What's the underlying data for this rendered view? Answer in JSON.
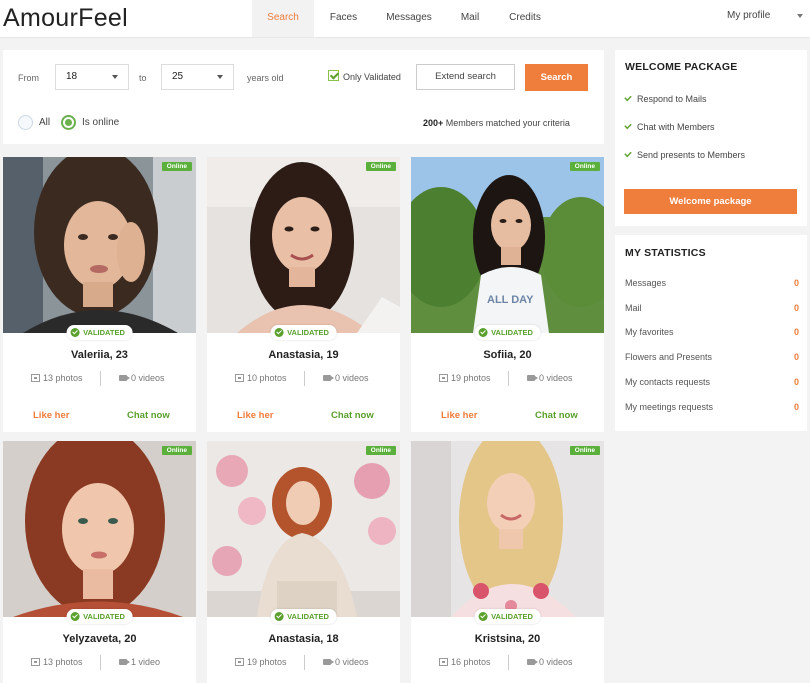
{
  "header": {
    "logo": "AmourFeel",
    "nav": [
      {
        "label": "Search",
        "active": true
      },
      {
        "label": "Faces",
        "active": false
      },
      {
        "label": "Messages",
        "active": false
      },
      {
        "label": "Mail",
        "active": false
      },
      {
        "label": "Credits",
        "active": false
      }
    ],
    "profile_label": "My profile"
  },
  "search": {
    "from_label": "From",
    "from_value": "18",
    "to_label": "to",
    "to_value": "25",
    "years_label": "years old",
    "only_validated_label": "Only Validated",
    "only_validated_checked": true,
    "extend_label": "Extend search",
    "search_label": "Search",
    "radio_all_label": "All",
    "radio_online_label": "Is online",
    "radio_selected": "online",
    "matched_count": "200+",
    "matched_text": "Members matched your criteria"
  },
  "profiles": [
    {
      "name": "Valeriia, 23",
      "photos": "13 photos",
      "videos": "0 videos",
      "online": "Online",
      "validated": "VALIDATED",
      "like": "Like her",
      "chat": "Chat now"
    },
    {
      "name": "Anastasia, 19",
      "photos": "10 photos",
      "videos": "0 videos",
      "online": "Online",
      "validated": "VALIDATED",
      "like": "Like her",
      "chat": "Chat now"
    },
    {
      "name": "Sofiia, 20",
      "photos": "19 photos",
      "videos": "0 videos",
      "online": "Online",
      "validated": "VALIDATED",
      "like": "Like her",
      "chat": "Chat now"
    },
    {
      "name": "Yelyzaveta, 20",
      "photos": "13 photos",
      "videos": "1 video",
      "online": "Online",
      "validated": "VALIDATED"
    },
    {
      "name": "Anastasia, 18",
      "photos": "19 photos",
      "videos": "0 videos",
      "online": "Online",
      "validated": "VALIDATED"
    },
    {
      "name": "Kristsina, 20",
      "photos": "16 photos",
      "videos": "0 videos",
      "online": "Online",
      "validated": "VALIDATED"
    }
  ],
  "welcome_package": {
    "title": "WELCOME PACKAGE",
    "items": [
      "Respond to Mails",
      "Chat with Members",
      "Send presents to Members"
    ],
    "button": "Welcome package"
  },
  "statistics": {
    "title": "MY STATISTICS",
    "rows": [
      {
        "label": "Messages",
        "value": "0"
      },
      {
        "label": "Mail",
        "value": "0"
      },
      {
        "label": "My favorites",
        "value": "0"
      },
      {
        "label": "Flowers and Presents",
        "value": "0"
      },
      {
        "label": "My contacts requests",
        "value": "0"
      },
      {
        "label": "My meetings requests",
        "value": "0"
      }
    ]
  },
  "colors": {
    "accent": "#ef7d3c",
    "green": "#5aa02c",
    "online_badge": "#5ab03a"
  }
}
